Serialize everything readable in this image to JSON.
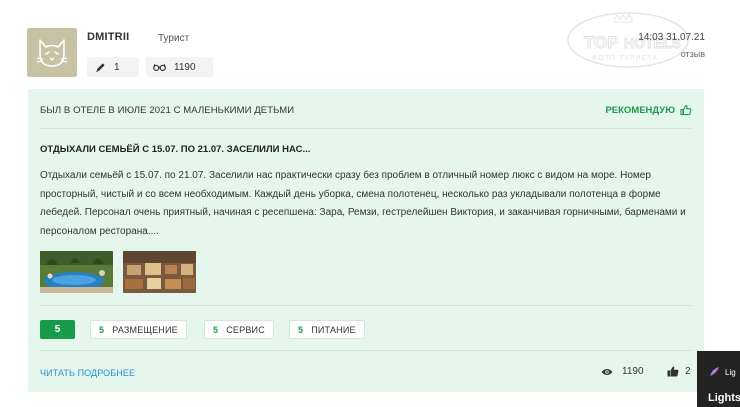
{
  "user": {
    "name": "DMITRII",
    "role": "Турист",
    "reviews_count": "1",
    "views_count": "1190"
  },
  "meta": {
    "timestamp": "14:03 31.07.21",
    "type_label": "отзыв",
    "watermark_top": "TOP",
    "watermark_hotels": "HOTELS",
    "watermark_sub": "ФОТО ТУРИСТА"
  },
  "review": {
    "trip_info": "БЫЛ В ОТЕЛЕ  В ИЮЛЕ 2021  С МАЛЕНЬКИМИ ДЕТЬМИ",
    "recommend_label": "РЕКОМЕНДУЮ",
    "title": "ОТДЫХАЛИ СЕМЬЁЙ С 15.07. ПО 21.07. ЗАСЕЛИЛИ НАС...",
    "text": "Отдыхали семьёй с 15.07. по 21.07. Заселили нас практически сразу без проблем в отличный номер люкс с видом на море. Номер просторный, чистый и со всем необходимым. Каждый день уборка, смена полотенец, несколько раз укладывали полотенца в форме лебедей. Персонал очень приятный, начиная с ресепшена: Зара, Ремзи, гестрелейшен Виктория, и заканчивая горничными, барменами и персоналом ресторана....",
    "overall_score": "5",
    "scores": [
      {
        "value": "5",
        "label": "РАЗМЕЩЕНИЕ"
      },
      {
        "value": "5",
        "label": "СЕРВИС"
      },
      {
        "value": "5",
        "label": "ПИТАНИЕ"
      }
    ],
    "read_more": "ЧИТАТЬ ПОДРОБНЕЕ",
    "views": "1190",
    "likes": "2"
  },
  "widget": {
    "line1": "Lig",
    "line2": "Lights"
  },
  "colors": {
    "accent_green": "#1a9b4b",
    "card_bg": "#e5f6ec",
    "link_blue": "#2a8fd4"
  }
}
